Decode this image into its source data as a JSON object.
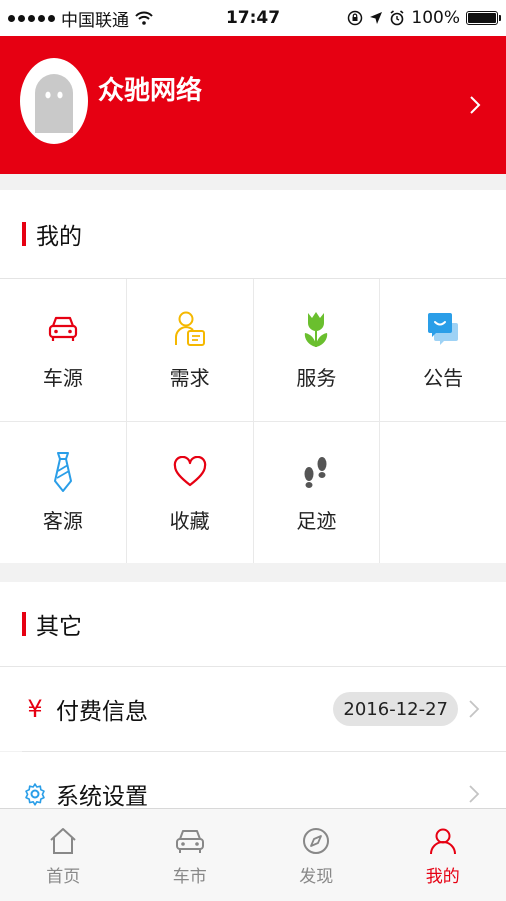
{
  "status_bar": {
    "carrier": "中国联通",
    "time": "17:47",
    "battery": "100%"
  },
  "profile": {
    "username": "众驰网络"
  },
  "my_section": {
    "title": "我的",
    "items": [
      {
        "label": "车源",
        "icon": "car-icon"
      },
      {
        "label": "需求",
        "icon": "person-list-icon"
      },
      {
        "label": "服务",
        "icon": "flower-icon"
      },
      {
        "label": "公告",
        "icon": "chat-icon"
      },
      {
        "label": "客源",
        "icon": "tie-icon"
      },
      {
        "label": "收藏",
        "icon": "heart-icon"
      },
      {
        "label": "足迹",
        "icon": "footprint-icon"
      }
    ]
  },
  "other_section": {
    "title": "其它",
    "rows": [
      {
        "label": "付费信息",
        "icon": "yen-icon",
        "date": "2016-12-27"
      },
      {
        "label": "系统设置",
        "icon": "gear-icon"
      }
    ]
  },
  "tabbar": {
    "tabs": [
      {
        "label": "首页",
        "icon": "home-icon",
        "active": false
      },
      {
        "label": "车市",
        "icon": "car-market-icon",
        "active": false
      },
      {
        "label": "发现",
        "icon": "compass-icon",
        "active": false
      },
      {
        "label": "我的",
        "icon": "user-icon",
        "active": true
      }
    ]
  },
  "colors": {
    "accent": "#e60012",
    "yellow": "#f5b800",
    "green": "#6abf2e",
    "blue": "#2a9ee8"
  }
}
